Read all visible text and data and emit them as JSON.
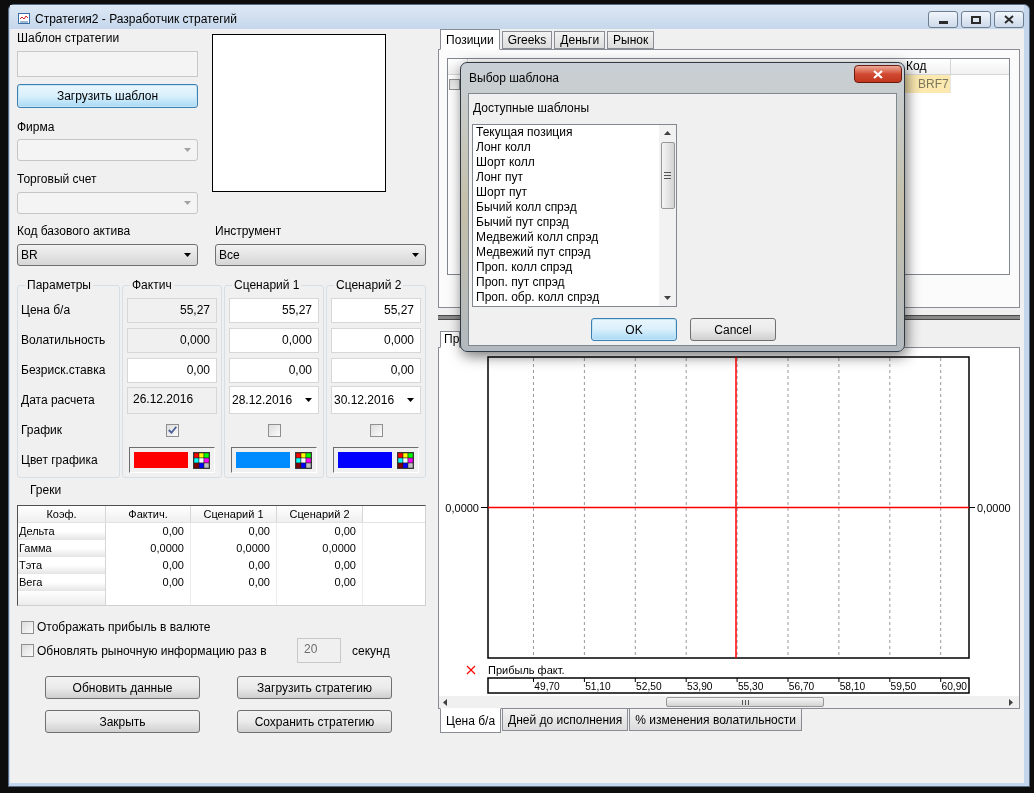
{
  "window": {
    "title": "Стратегия2 - Разработчик стратегий"
  },
  "template": {
    "label": "Шаблон стратегии",
    "button": {
      "label": "Загрузить шаблон",
      "focused": true
    }
  },
  "firm": {
    "label": "Фирма",
    "disabled": true
  },
  "account": {
    "label": "Торговый счет",
    "disabled": true
  },
  "base_asset": {
    "label": "Код базового актива",
    "value": "BR",
    "disabled": false
  },
  "instrument": {
    "label": "Инструмент",
    "value": "Все",
    "disabled": false
  },
  "parameters": {
    "title": "Параметры",
    "labels": [
      "Цена б/а",
      "Волатильность",
      "Безриск.ставка",
      "Дата расчета",
      "График",
      "Цвет графика"
    ],
    "scenarios": [
      {
        "title": "Фактич",
        "fields": [
          {
            "kind": "number",
            "value": "55,27",
            "readonly": true
          },
          {
            "kind": "number",
            "value": "0,000",
            "readonly": true
          },
          {
            "kind": "number",
            "value": "0,00",
            "readonly": false
          },
          {
            "kind": "date",
            "value": "26.12.2016",
            "readonly": true
          },
          {
            "kind": "checkbox",
            "checked": true
          },
          {
            "kind": "color",
            "color": "#ff0000"
          }
        ]
      },
      {
        "title": "Сценарий 1",
        "fields": [
          {
            "kind": "number",
            "value": "55,27",
            "readonly": false
          },
          {
            "kind": "number",
            "value": "0,000",
            "readonly": false
          },
          {
            "kind": "number",
            "value": "0,00",
            "readonly": false
          },
          {
            "kind": "date",
            "value": "28.12.2016",
            "readonly": false
          },
          {
            "kind": "checkbox",
            "checked": false
          },
          {
            "kind": "color",
            "color": "#008cff"
          }
        ]
      },
      {
        "title": "Сценарий 2",
        "fields": [
          {
            "kind": "number",
            "value": "55,27",
            "readonly": false
          },
          {
            "kind": "number",
            "value": "0,000",
            "readonly": false
          },
          {
            "kind": "number",
            "value": "0,00",
            "readonly": false
          },
          {
            "kind": "date",
            "value": "30.12.2016",
            "readonly": false
          },
          {
            "kind": "checkbox",
            "checked": false
          },
          {
            "kind": "color",
            "color": "#0000ff"
          }
        ]
      }
    ]
  },
  "greeks": {
    "title": "Греки",
    "columns": [
      "Коэф.",
      "Фактич.",
      "Сценарий 1",
      "Сценарий 2"
    ],
    "rows": [
      [
        "Дельта",
        "0,00",
        "0,00",
        "0,00"
      ],
      [
        "Гамма",
        "0,0000",
        "0,0000",
        "0,0000"
      ],
      [
        "Тэта",
        "0,00",
        "0,00",
        "0,00"
      ],
      [
        "Вега",
        "0,00",
        "0,00",
        "0,00"
      ]
    ]
  },
  "options": [
    {
      "label": "Отображать прибыль в валюте",
      "checked": false
    },
    {
      "label": "Обновлять рыночную информацию раз в",
      "checked": false
    }
  ],
  "refresh": {
    "value": "20",
    "unit": "секунд",
    "disabled": true
  },
  "buttons": [
    "Обновить данные",
    "Загрузить стратегию",
    "Закрыть",
    "Сохранить стратегию"
  ],
  "positions_tabs": [
    {
      "label": "Позиции",
      "selected": true
    },
    {
      "label": "Greeks",
      "selected": false
    },
    {
      "label": "Деньги",
      "selected": false
    },
    {
      "label": "Рынок",
      "selected": false
    }
  ],
  "positions_table": {
    "columns": [
      "Код"
    ],
    "rows": [
      {
        "code": "BRF7",
        "checked": false,
        "selected": true
      }
    ]
  },
  "chart_tabs": [
    {
      "label": "Пр",
      "selected": true
    }
  ],
  "chart_panel": {
    "zero_labels": [
      "0,0000",
      "0,0000"
    ],
    "legend": "Прибыль факт.",
    "x_labels": [
      "49,70",
      "51,10",
      "52,50",
      "53,90",
      "55,30",
      "56,70",
      "58,10",
      "59,50",
      "60,90"
    ]
  },
  "axis_tabs": [
    {
      "label": "Цена б/а",
      "selected": true
    },
    {
      "label": "Дней до исполнения",
      "selected": false
    },
    {
      "label": "% изменения волатильности",
      "selected": false
    }
  ],
  "dialog": {
    "title": "Выбор шаблона",
    "list_label": "Доступные шаблоны",
    "items": [
      {
        "label": "Текущая позиция",
        "selected": false
      },
      {
        "label": "Лонг колл",
        "selected": false
      },
      {
        "label": "Шорт колл",
        "selected": false
      },
      {
        "label": "Лонг пут",
        "selected": false
      },
      {
        "label": "Шорт пут",
        "selected": false
      },
      {
        "label": "Бычий колл спрэд",
        "selected": false
      },
      {
        "label": "Бычий пут спрэд",
        "selected": false
      },
      {
        "label": "Медвежий колл спрэд",
        "selected": false
      },
      {
        "label": "Медвежий пут спрэд",
        "selected": false
      },
      {
        "label": "Проп. колл спрэд",
        "selected": false
      },
      {
        "label": "Проп. пут спрэд",
        "selected": false
      },
      {
        "label": "Проп. обр. колл спрэд",
        "selected": false
      }
    ],
    "buttons": [
      {
        "label": "OK",
        "focused": true
      },
      {
        "label": "Cancel",
        "focused": false
      }
    ]
  }
}
